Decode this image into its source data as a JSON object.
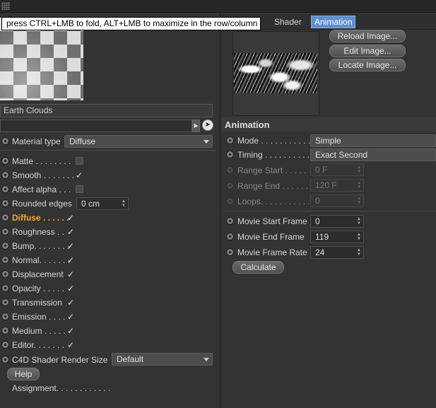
{
  "tooltip": "press CTRL+LMB to fold, ALT+LMB to maximize in the row/column",
  "material": {
    "name": "Earth Clouds",
    "path": "",
    "type_label": "Material type",
    "type_value": "Diffuse"
  },
  "properties": [
    {
      "label": "Matte . . . . . . . .",
      "state": "box"
    },
    {
      "label": "Smooth . . . . . . .",
      "state": "check"
    },
    {
      "label": "Affect alpha . . .",
      "state": "box"
    },
    {
      "label": "Rounded edges",
      "state": "field",
      "value": "0 cm"
    },
    {
      "label": "Diffuse . . . . . .",
      "state": "check",
      "highlight": true
    },
    {
      "label": "Roughness . .",
      "state": "check"
    },
    {
      "label": "Bump. . . . . . . .",
      "state": "check"
    },
    {
      "label": "Normal. . . . . . .",
      "state": "check"
    },
    {
      "label": "Displacement",
      "state": "check"
    },
    {
      "label": "Opacity . . . . .",
      "state": "check"
    },
    {
      "label": "Transmission",
      "state": "check"
    },
    {
      "label": "Emission . . . .",
      "state": "check"
    },
    {
      "label": "Medium . . . . .",
      "state": "check"
    },
    {
      "label": "Editor. . . . . . .",
      "state": "check"
    }
  ],
  "render_size": {
    "label": "C4D Shader Render Size",
    "value": "Default"
  },
  "help_button": "Help",
  "assignment": "Assignment. . . . . . . . . . . .",
  "tabs": [
    "Shader",
    "Animation"
  ],
  "image_buttons": [
    "Reload Image...",
    "Edit Image...",
    "Locate Image..."
  ],
  "animation": {
    "title": "Animation",
    "mode_label": "Mode . . . . . . . . . . .",
    "mode_value": "Simple",
    "timing_label": "Timing . . . . . . . . . .",
    "timing_value": "Exact Second",
    "range_start_label": "Range Start . . . . .",
    "range_start_value": "0 F",
    "range_end_label": "Range End . . . . . .",
    "range_end_value": "120 F",
    "loops_label": "Loops. . . . . . . . . . .",
    "loops_value": "0",
    "movie_start_label": "Movie Start Frame",
    "movie_start_value": "0",
    "movie_end_label": "Movie End Frame",
    "movie_end_value": "119",
    "movie_rate_label": "Movie Frame Rate",
    "movie_rate_value": "24",
    "calculate_button": "Calculate"
  },
  "icons": {
    "grip": "grip-icon",
    "picker": "pointer-picker-icon",
    "check": "✓"
  },
  "colors": {
    "accent_tab": "#5d8fd3",
    "highlight_label": "#f5a623",
    "background": "#333333"
  }
}
